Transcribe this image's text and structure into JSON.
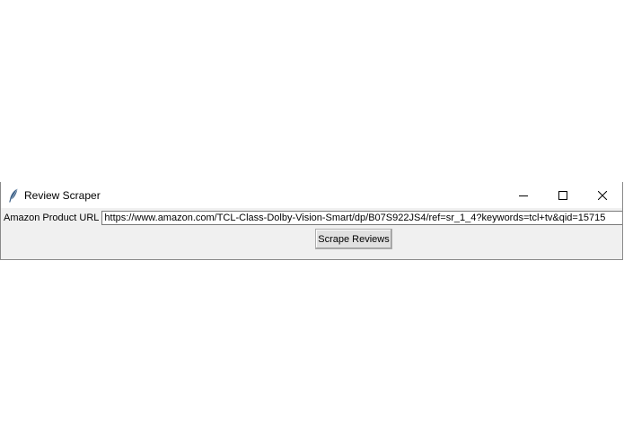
{
  "window": {
    "title": "Review Scraper",
    "icon": "feather-icon",
    "controls": {
      "minimize_icon": "minimize-icon",
      "maximize_icon": "maximize-icon",
      "close_icon": "close-icon"
    }
  },
  "form": {
    "url_label": "Amazon Product URL",
    "url_value": "https://www.amazon.com/TCL-Class-Dolby-Vision-Smart/dp/B07S922JS4/ref=sr_1_4?keywords=tcl+tv&qid=15715",
    "submit_label": "Scrape Reviews"
  },
  "colors": {
    "window_bg": "#f0f0f0",
    "titlebar_bg": "#ffffff",
    "feather_icon": "#3b5f86"
  }
}
